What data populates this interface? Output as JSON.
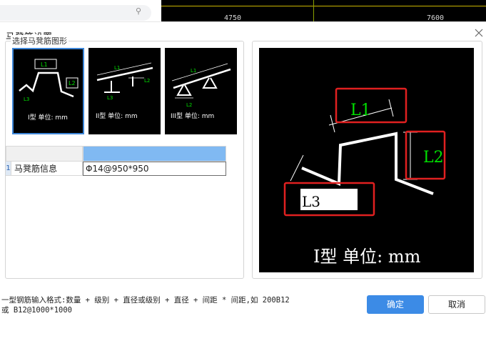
{
  "background": {
    "cad_numbers": [
      "4750",
      "7600"
    ]
  },
  "dialog": {
    "title": "马凳筋设置",
    "group_title": "选择马凳筋图形",
    "shapes": [
      {
        "caption": "I型 单位: mm",
        "labels": [
          "L1",
          "L2",
          "L3"
        ],
        "selected": true
      },
      {
        "caption": "II型 单位: mm",
        "labels": [
          "L1",
          "L2",
          "L3"
        ],
        "selected": false
      },
      {
        "caption": "III型 单位: mm",
        "labels": [
          "L1",
          "L2"
        ],
        "selected": false
      }
    ],
    "grid": {
      "row_number": "1",
      "row_label": "马凳筋信息",
      "row_value": "Φ14@950*950"
    },
    "preview": {
      "caption": "I型 单位: mm",
      "labels": {
        "l1": "L1",
        "l2": "L2",
        "l3": "L3"
      }
    },
    "hint_line1": "一型钢筋输入格式:数量 + 级别 + 直径或级别 + 直径 + 间距 * 间距,如 200B12",
    "hint_line2": "或 B12@1000*1000",
    "ok_label": "确定",
    "cancel_label": "取消"
  },
  "colors": {
    "accent": "#3c8be6",
    "highlight_box": "#e02020",
    "dim_green": "#00e000"
  }
}
